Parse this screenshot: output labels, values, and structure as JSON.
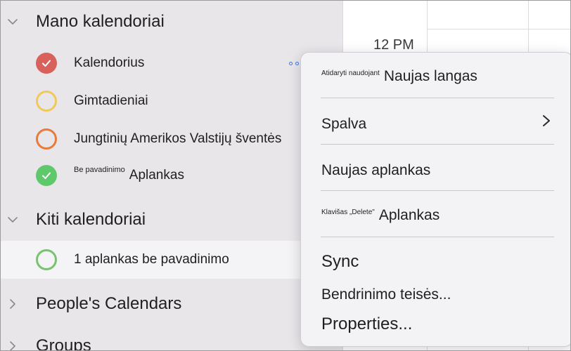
{
  "sidebar": {
    "my_calendars": {
      "title": "Mano kalendoriai",
      "items": [
        {
          "name": "Kalendorius",
          "color": "#d9615b",
          "checked": true
        },
        {
          "name": "Gimtadieniai",
          "color": "#f0c95a",
          "checked": false
        },
        {
          "name": "Jungtinių Amerikos Valstijų šventės",
          "color": "#e97b3a",
          "checked": false
        },
        {
          "small": "Be pavadinimo",
          "name": "Aplankas",
          "color": "#5ec96a",
          "checked": true
        }
      ]
    },
    "other_calendars": {
      "title": "Kiti kalendoriai",
      "items": [
        {
          "name": "1 aplankas be pavadinimo",
          "color": "#79c26f",
          "checked": false
        }
      ]
    },
    "peoples_calendars": {
      "title": "People's Calendars"
    },
    "groups": {
      "title": "Groups"
    }
  },
  "calendar": {
    "time_label": "12 PM"
  },
  "context_menu": {
    "open_with_small": "Atidaryti naudojant",
    "open_with": "Naujas langas",
    "color": "Spalva",
    "new_folder": "Naujas aplankas",
    "delete_small": "Klavišas „Delete\"",
    "delete": "Aplankas",
    "sync": "Sync",
    "sharing": "Bendrinimo teisės...",
    "properties": "Properties..."
  }
}
